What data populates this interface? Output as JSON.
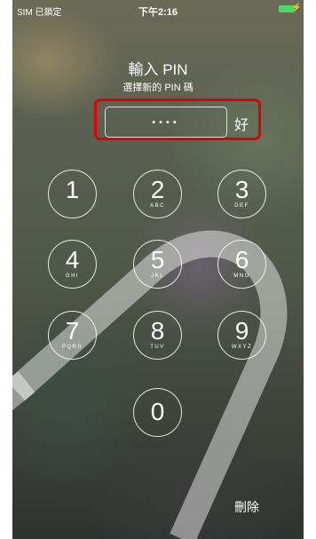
{
  "status_bar": {
    "carrier": "SIM 已鎖定",
    "time": "下午2:16"
  },
  "prompt": {
    "title": "輸入 PIN",
    "subtitle": "選擇新的 PIN 碼"
  },
  "pin_field": {
    "value": "••••"
  },
  "ok_label": "好",
  "keypad": [
    {
      "digit": "1",
      "letters": ""
    },
    {
      "digit": "2",
      "letters": "ABC"
    },
    {
      "digit": "3",
      "letters": "DEF"
    },
    {
      "digit": "4",
      "letters": "GHI"
    },
    {
      "digit": "5",
      "letters": "JKL"
    },
    {
      "digit": "6",
      "letters": "MNO"
    },
    {
      "digit": "7",
      "letters": "PQRS"
    },
    {
      "digit": "8",
      "letters": "TUV"
    },
    {
      "digit": "9",
      "letters": "WXYZ"
    },
    {
      "digit": "0",
      "letters": ""
    }
  ],
  "delete_label": "刪除",
  "colors": {
    "highlight": "#e00000",
    "battery": "#4cd964"
  }
}
